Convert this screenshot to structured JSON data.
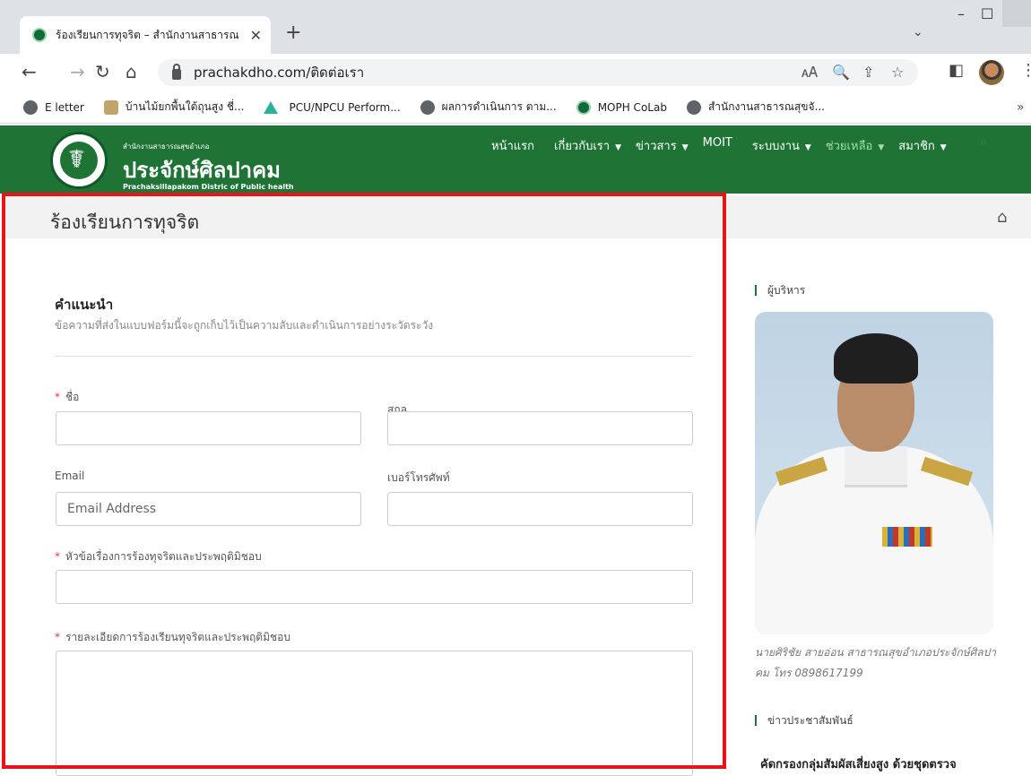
{
  "browser": {
    "tab_title": "ร้องเรียนการทุจริต – สำนักงานสาธารณ",
    "tab_close": "✕",
    "new_tab": "+",
    "tab_search": "⌄",
    "win_minimize": "–",
    "win_maximize": "☐",
    "url": "prachakdho.com/ติดต่อเรา",
    "back": "←",
    "forward": "→",
    "reload": "↻",
    "home": "⌂",
    "translate": "🗚",
    "zoom": "🔍",
    "share": "⇪",
    "star": "☆",
    "sidepanel": "◧",
    "menu": "⋮",
    "bookmarks": [
      {
        "label": "E letter",
        "icon": "globe-icon"
      },
      {
        "label": "บ้านไม้ยกพื้นใต้ถุนสูง ชี่...",
        "icon": "emblem-icon"
      },
      {
        "label": "PCU/NPCU Perform...",
        "icon": "triangle-logo-icon"
      },
      {
        "label": "ผลการดำเนินการ ตาม...",
        "icon": "globe-icon"
      },
      {
        "label": "MOPH CoLab",
        "icon": "moph-icon"
      },
      {
        "label": "สำนักงานสาธารณสุขจั...",
        "icon": "globe-icon"
      }
    ],
    "bookmarks_more": "»"
  },
  "site": {
    "logo_small": "สำนักงานสาธารณสุขอำเภอ",
    "logo_name": "ประจักษ์ศิลปาคม",
    "logo_en": "Prachaksillapakom Distric of Public health",
    "menu": [
      {
        "label": "หน้าแรก",
        "caret": ""
      },
      {
        "label": "เกี่ยวกับเรา",
        "caret": "▼"
      },
      {
        "label": "ข่าวสาร",
        "caret": "▼"
      },
      {
        "label": "MOIT",
        "caret": ""
      },
      {
        "label": "ระบบงาน",
        "caret": "▼"
      },
      {
        "label": "ช่วยเหลือ",
        "caret": "▼"
      },
      {
        "label": "สมาชิก",
        "caret": "▼"
      }
    ],
    "search_icon": "⌕"
  },
  "page": {
    "title": "ร้องเรียนการทุจริต",
    "home_icon": "⌂"
  },
  "form": {
    "section_title": "คำแนะนำ",
    "section_desc": "ข้อความที่ส่งในแบบฟอร์มนี้จะถูกเก็บไว้เป็นความลับและดำเนินการอย่างระวัดระวัง",
    "required_mark": "*",
    "first_name_label": "ชื่อ",
    "last_name_label": "สกุล",
    "email_label": "Email",
    "email_placeholder": "Email Address",
    "phone_label": "เบอร์โทรศัพท์",
    "subject_label": "หัวข้อเรื่องการร้องทุจริตและประพฤติมิชอบ",
    "detail_label": "รายละเอียดการร้องเรียนทุจริตและประพฤติมิชอบ"
  },
  "sidebar": {
    "director_heading": "ผู้บริหาร",
    "director_caption": "นายศิริชัย สายอ่อน สาธารณสุขอำเภอประจักษ์ศิลปาคม โทร 0898617199",
    "news_heading": "ข่าวประชาสัมพันธ์",
    "news_first_title": "คัดกรองกลุ่มสัมผัสเสี่ยงสูง ด้วยชุดตรวจ"
  },
  "colors": {
    "header_green": "#1e7335",
    "highlight_frame": "#e8141a",
    "required": "#e53935"
  }
}
